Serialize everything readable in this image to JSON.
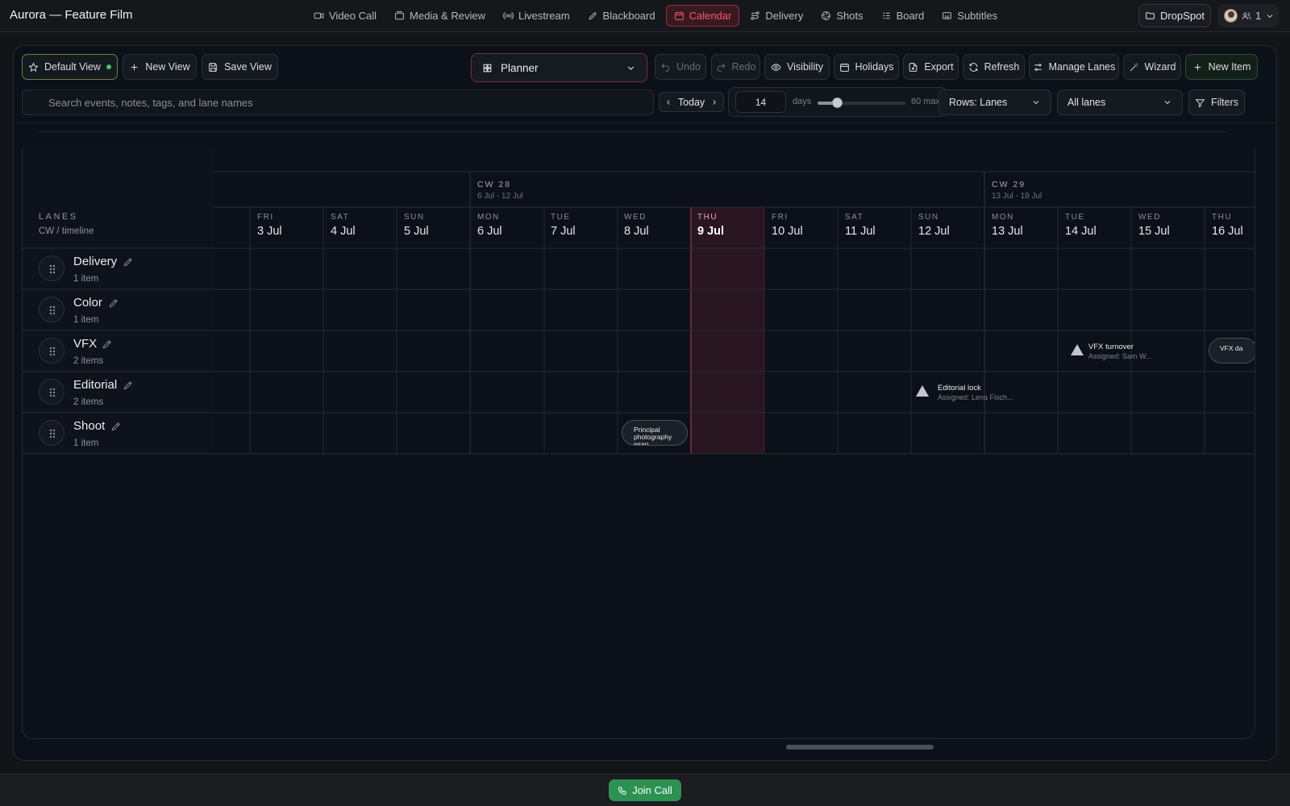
{
  "app": {
    "title": "Aurora — Feature Film"
  },
  "nav": [
    {
      "label": "Video Call",
      "icon": "video-icon",
      "active": false
    },
    {
      "label": "Media & Review",
      "icon": "media-icon",
      "active": false
    },
    {
      "label": "Livestream",
      "icon": "broadcast-icon",
      "active": false
    },
    {
      "label": "Blackboard",
      "icon": "pen-icon",
      "active": false
    },
    {
      "label": "Calendar",
      "icon": "calendar-icon",
      "active": true
    },
    {
      "label": "Delivery",
      "icon": "route-icon",
      "active": false
    },
    {
      "label": "Shots",
      "icon": "aperture-icon",
      "active": false
    },
    {
      "label": "Board",
      "icon": "list-icon",
      "active": false
    },
    {
      "label": "Subtitles",
      "icon": "captions-icon",
      "active": false
    }
  ],
  "header_right": {
    "dropspot": "DropSpot",
    "users_count": "1"
  },
  "toolbar": {
    "default_view": "Default View",
    "new_view": "New View",
    "save_view": "Save View",
    "planner": "Planner",
    "undo": "Undo",
    "redo": "Redo",
    "visibility": "Visibility",
    "holidays": "Holidays",
    "export": "Export",
    "refresh": "Refresh",
    "manage_lanes": "Manage Lanes",
    "wizard": "Wizard",
    "new_item": "New Item"
  },
  "controls": {
    "search_placeholder": "Search events, notes, tags, and lane names",
    "today": "Today",
    "days_value": "14",
    "days_label": "days",
    "days_max_label": "60 max",
    "days_min": 1,
    "days_max": 60,
    "rows": "Rows: Lanes",
    "lanes_filter": "All lanes",
    "filters": "Filters"
  },
  "calendar": {
    "lanes_title": "LANES",
    "lanes_subtitle": "CW / timeline",
    "weeks": [
      {
        "title": "CW 28",
        "range": "6 Jul - 12 Jul"
      },
      {
        "title": "CW 29",
        "range": "13 Jul - 19 Jul"
      }
    ],
    "days": [
      {
        "dow": "FRI",
        "date": "3 Jul"
      },
      {
        "dow": "SAT",
        "date": "4 Jul"
      },
      {
        "dow": "SUN",
        "date": "5 Jul"
      },
      {
        "dow": "MON",
        "date": "6 Jul"
      },
      {
        "dow": "TUE",
        "date": "7 Jul"
      },
      {
        "dow": "WED",
        "date": "8 Jul"
      },
      {
        "dow": "THU",
        "date": "9 Jul",
        "today": true
      },
      {
        "dow": "FRI",
        "date": "10 Jul"
      },
      {
        "dow": "SAT",
        "date": "11 Jul"
      },
      {
        "dow": "SUN",
        "date": "12 Jul"
      },
      {
        "dow": "MON",
        "date": "13 Jul"
      },
      {
        "dow": "TUE",
        "date": "14 Jul"
      },
      {
        "dow": "WED",
        "date": "15 Jul"
      },
      {
        "dow": "THU",
        "date": "16 Jul"
      }
    ],
    "lanes": [
      {
        "name": "Delivery",
        "count": "1 item"
      },
      {
        "name": "Color",
        "count": "1 item"
      },
      {
        "name": "VFX",
        "count": "2 items"
      },
      {
        "name": "Editorial",
        "count": "2 items"
      },
      {
        "name": "Shoot",
        "count": "1 item"
      }
    ],
    "events": [
      {
        "lane": "VFX",
        "day": "14 Jul",
        "kind": "milestone",
        "title": "VFX turnover",
        "subtitle": "Assigned: Sam W..."
      },
      {
        "lane": "VFX",
        "day": "16 Jul",
        "kind": "item",
        "title": "VFX da"
      },
      {
        "lane": "Editorial",
        "day": "12 Jul",
        "kind": "milestone",
        "title": "Editorial lock",
        "subtitle": "Assigned: Lena Fisch..."
      },
      {
        "lane": "Shoot",
        "day": "8 Jul",
        "kind": "item",
        "title": "Principal photography wrap"
      }
    ]
  },
  "colors": {
    "accent": "#f05a7a",
    "today_bg": "#2a1621",
    "join_call": "#2d9152"
  },
  "footer": {
    "join_call": "Join Call"
  }
}
